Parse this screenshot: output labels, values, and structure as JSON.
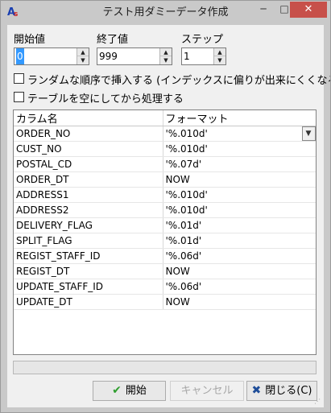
{
  "window": {
    "title": "テスト用ダミーデータ作成",
    "app_icon_letter": "A",
    "app_icon_sub": "s",
    "min_glyph": "─",
    "max_glyph": "□",
    "close_glyph": "✕"
  },
  "fields": {
    "start_label": "開始値",
    "start_value": "0",
    "end_label": "終了値",
    "end_value": "999",
    "step_label": "ステップ",
    "step_value": "1",
    "spin_up": "▲",
    "spin_down": "▼"
  },
  "options": {
    "random_order_label": "ランダムな順序で挿入する (インデックスに偏りが出来にくくなる)",
    "random_order_checked": false,
    "clear_table_label": "テーブルを空にしてから処理する",
    "clear_table_checked": false
  },
  "grid": {
    "headers": [
      "カラム名",
      "フォーマット"
    ],
    "combo_arrow": "▼",
    "rows": [
      {
        "column": "ORDER_NO",
        "format": "'%.010d'"
      },
      {
        "column": "CUST_NO",
        "format": "'%.010d'"
      },
      {
        "column": "POSTAL_CD",
        "format": "'%.07d'"
      },
      {
        "column": "ORDER_DT",
        "format": "NOW"
      },
      {
        "column": "ADDRESS1",
        "format": "'%.010d'"
      },
      {
        "column": "ADDRESS2",
        "format": "'%.010d'"
      },
      {
        "column": "DELIVERY_FLAG",
        "format": "'%.01d'"
      },
      {
        "column": "SPLIT_FLAG",
        "format": "'%.01d'"
      },
      {
        "column": "REGIST_STAFF_ID",
        "format": "'%.06d'"
      },
      {
        "column": "REGIST_DT",
        "format": "NOW"
      },
      {
        "column": "UPDATE_STAFF_ID",
        "format": "'%.06d'"
      },
      {
        "column": "UPDATE_DT",
        "format": "NOW"
      }
    ]
  },
  "progress": {
    "value": 0
  },
  "buttons": {
    "start_label": "開始",
    "start_icon": "✔",
    "cancel_label": "キャンセル",
    "close_label": "閉じる(C)",
    "close_icon": "✖"
  },
  "colors": {
    "selection": "#3399ff",
    "close_button": "#c7504a",
    "start_icon": "#2e9e2e"
  }
}
